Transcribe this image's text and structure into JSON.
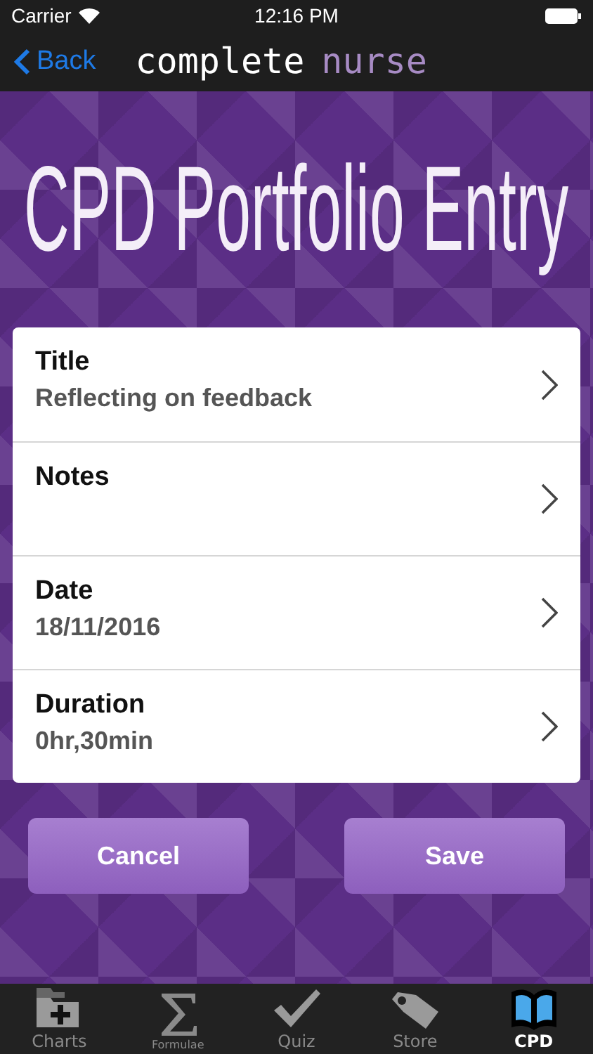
{
  "status_bar": {
    "carrier": "Carrier",
    "time": "12:16 PM"
  },
  "nav": {
    "back": "Back",
    "title_main": "complete",
    "title_accent": "nurse"
  },
  "header": "CPD Portfolio Entry",
  "fields": [
    {
      "label": "Title",
      "value": "Reflecting on feedback"
    },
    {
      "label": "Notes"
    },
    {
      "label": "Date",
      "value": "18/11/2016"
    },
    {
      "label": "Duration",
      "value": "0hr,30min"
    }
  ],
  "buttons": [
    {
      "label": "Cancel"
    },
    {
      "label": "Save"
    }
  ],
  "tabs": [
    {
      "label": "Charts",
      "kind": "folder",
      "selected": false
    },
    {
      "label": "Formulae",
      "kind": "sigma",
      "selected": false
    },
    {
      "label": "Quiz",
      "kind": "check",
      "selected": false
    },
    {
      "label": "Store",
      "kind": "tag",
      "selected": false
    },
    {
      "label": "CPD",
      "kind": "book",
      "selected": true
    }
  ]
}
